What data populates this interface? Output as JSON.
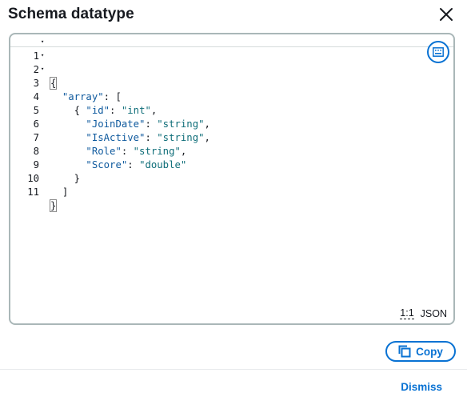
{
  "modal": {
    "title": "Schema datatype",
    "close_icon": "close-icon",
    "copy_label": "Copy",
    "copy_icon": "copy-icon",
    "dismiss_label": "Dismiss"
  },
  "editor": {
    "keyboard_icon": "keyboard-icon",
    "cursor_position": "1:1",
    "language": "JSON",
    "lines": [
      {
        "num": "1",
        "fold": "▾"
      },
      {
        "num": "2",
        "fold": "▾"
      },
      {
        "num": "3",
        "fold": "▾"
      },
      {
        "num": "4",
        "fold": ""
      },
      {
        "num": "5",
        "fold": ""
      },
      {
        "num": "6",
        "fold": ""
      },
      {
        "num": "7",
        "fold": ""
      },
      {
        "num": "8",
        "fold": ""
      },
      {
        "num": "9",
        "fold": ""
      },
      {
        "num": "10",
        "fold": ""
      },
      {
        "num": "11",
        "fold": ""
      }
    ],
    "code": {
      "open_brace": "{",
      "array_key": "\"array\"",
      "array_open": ": [",
      "obj_open": "{",
      "fields": [
        {
          "key": "\"id\"",
          "value": "\"int\"",
          "sep": ","
        },
        {
          "key": "\"JoinDate\"",
          "value": "\"string\"",
          "sep": ","
        },
        {
          "key": "\"IsActive\"",
          "value": "\"string\"",
          "sep": ","
        },
        {
          "key": "\"Role\"",
          "value": "\"string\"",
          "sep": ","
        },
        {
          "key": "\"Score\"",
          "value": "\"double\"",
          "sep": ""
        }
      ],
      "obj_close": "}",
      "array_close": "]",
      "close_brace": "}"
    }
  },
  "colors": {
    "accent": "#0972d3",
    "border": "#aab7b8",
    "json_key": "#0f5a9e",
    "json_string": "#0f6e79"
  }
}
